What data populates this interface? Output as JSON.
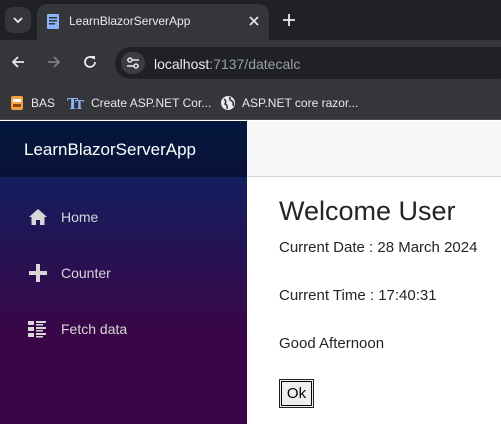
{
  "browser": {
    "tab_title": "LearnBlazorServerApp",
    "url_host": "localhost",
    "url_rest": ":7137/datecalc",
    "bookmarks": [
      {
        "label": "BAS",
        "icon": "bas-favicon-icon"
      },
      {
        "label": "Create ASP.NET Cor...",
        "icon": "tt-favicon-icon"
      },
      {
        "label": "ASP.NET core razor...",
        "icon": "globe-icon"
      }
    ]
  },
  "app": {
    "brand": "LearnBlazorServerApp",
    "nav": [
      {
        "label": "Home",
        "icon": "home-icon"
      },
      {
        "label": "Counter",
        "icon": "plus-icon"
      },
      {
        "label": "Fetch data",
        "icon": "list-icon"
      }
    ]
  },
  "page": {
    "title": "Welcome User",
    "current_date": "Current Date : 28 March 2024",
    "current_time": "Current Time : 17:40:31",
    "greeting": "Good Afternoon",
    "ok_label": "Ok"
  },
  "colors": {
    "sidebar_top": "#052767",
    "sidebar_bottom": "#3a0647",
    "chrome_dark": "#202124",
    "chrome_toolbar": "#35363a"
  }
}
